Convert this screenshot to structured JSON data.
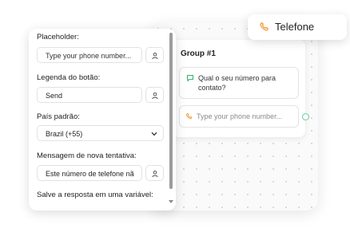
{
  "palette": {
    "accent_orange": "#f29b3b",
    "accent_green": "#35b36c",
    "connector_green": "#5fd39a"
  },
  "telefone_chip": {
    "icon": "phone-icon",
    "label": "Telefone"
  },
  "group": {
    "title": "Group #1",
    "question": {
      "icon": "chat-bubble-icon",
      "text": "Qual o seu número para contato?"
    },
    "phone_input_block": {
      "icon": "phone-icon",
      "placeholder": "Type your phone number..."
    }
  },
  "settings_panel": {
    "placeholder": {
      "label": "Placeholder:",
      "value": "Type your phone number...",
      "button_icon": "variable-icon"
    },
    "button_caption": {
      "label": "Legenda do botão:",
      "value": "Send",
      "button_icon": "variable-icon"
    },
    "default_country": {
      "label": "País padrão:",
      "selected": "Brazil (+55)"
    },
    "retry_message": {
      "label": "Mensagem de nova tentativa:",
      "value": "Este número de telefone nã",
      "button_icon": "variable-icon"
    },
    "save_variable": {
      "label": "Salve a resposta em uma variável:"
    }
  }
}
